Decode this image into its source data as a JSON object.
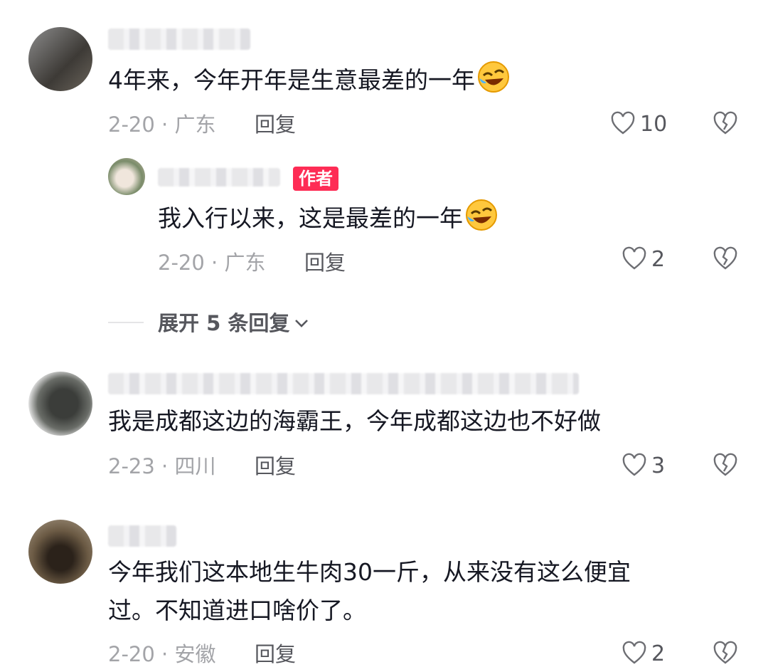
{
  "comments": [
    {
      "text": "4年来，今年开年是生意最差的一年",
      "emoji": "rofl-emoji",
      "date_loc": "2-20 · 广东",
      "reply_label": "回复",
      "likes": "10"
    },
    {
      "text": "我是成都这边的海霸王，今年成都这边也不好做",
      "date_loc": "2-23 · 四川",
      "reply_label": "回复",
      "likes": "3"
    },
    {
      "text_line1": "今年我们这本地生牛肉30一斤，从来没有这么便宜",
      "text_line2": "过。不知道进口啥价了。",
      "date_loc": "2-20 · 安徽",
      "reply_label": "回复",
      "likes": "2"
    }
  ],
  "reply": {
    "author_tag": "作者",
    "text": "我入行以来，这是最差的一年",
    "emoji": "rofl-emoji",
    "date_loc": "2-20 · 广东",
    "reply_label": "回复",
    "likes": "2"
  },
  "expand_replies": "展开 5 条回复",
  "colors": {
    "accent": "#fe2c55",
    "text": "#161823",
    "meta": "#a3a4a8"
  }
}
